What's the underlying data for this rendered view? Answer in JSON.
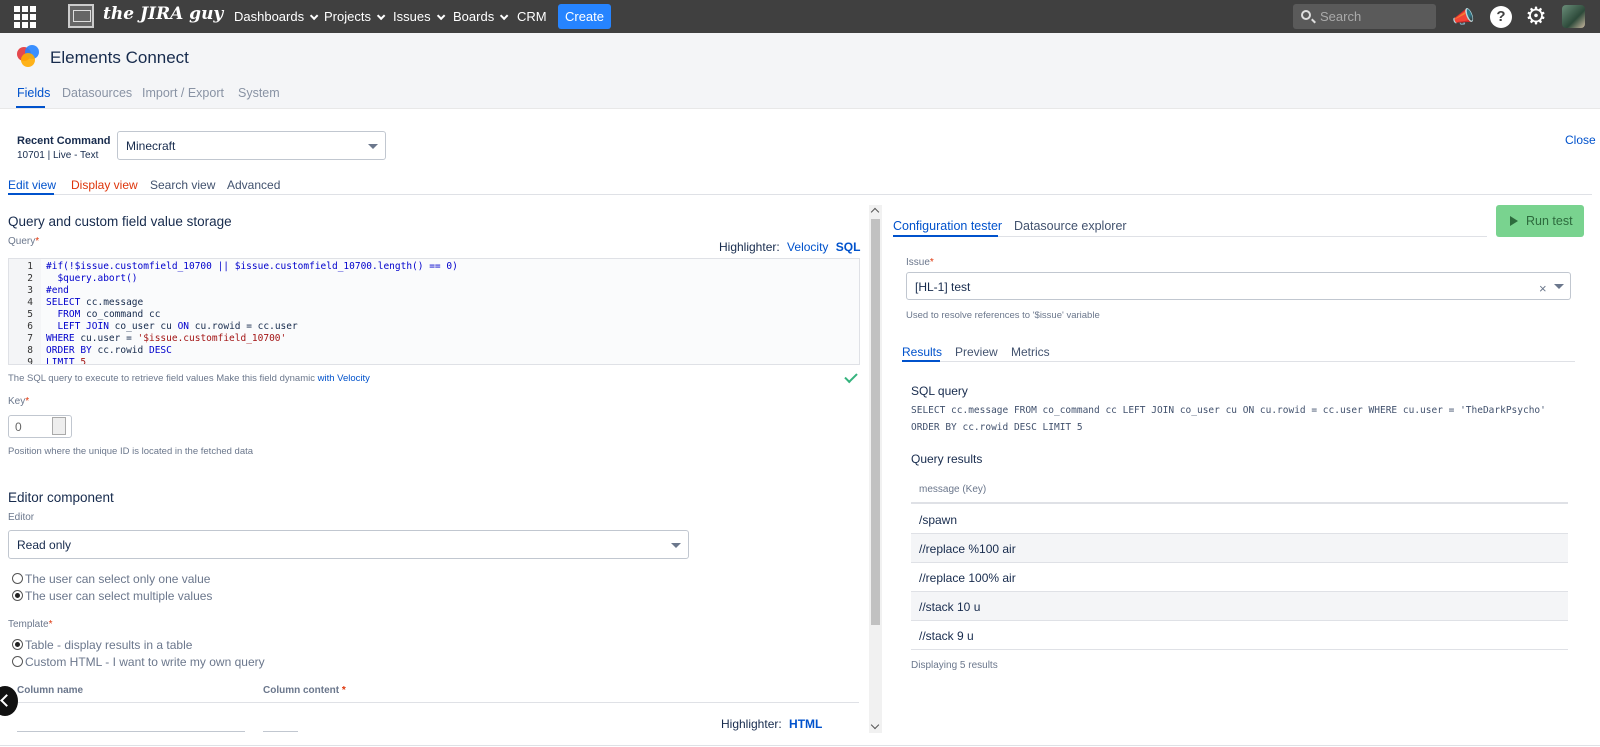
{
  "topnav": {
    "site_name": "the JIRA guy",
    "items": [
      {
        "label": "Dashboards"
      },
      {
        "label": "Projects"
      },
      {
        "label": "Issues"
      },
      {
        "label": "Boards"
      },
      {
        "label": "CRM"
      }
    ],
    "create_label": "Create",
    "search_placeholder": "Search",
    "help_glyph": "?",
    "icons": [
      "apps-grid-icon",
      "site-logo-icon",
      "megaphone-icon",
      "help-icon",
      "gear-icon",
      "avatar"
    ]
  },
  "header": {
    "title": "Elements Connect",
    "tabs": [
      "Fields",
      "Datasources",
      "Import / Export",
      "System"
    ],
    "active_tab": "Fields"
  },
  "field": {
    "name": "Recent Command",
    "meta": "10701 | Live - Text",
    "selected_context": "Minecraft",
    "close_label": "Close"
  },
  "view_tabs": [
    "Edit view",
    "Display view",
    "Search view",
    "Advanced"
  ],
  "left": {
    "section_title": "Query and custom field value storage",
    "query_label": "Query",
    "required_mark": "*",
    "highlighter_label": "Highlighter:",
    "highlighter_options": [
      "Velocity",
      "SQL"
    ],
    "query_help_text": "The SQL query to execute to retrieve field values Make this field dynamic ",
    "query_help_link": "with Velocity",
    "key_label": "Key",
    "key_value": "0",
    "key_help": "Position where the unique ID is located in the fetched data",
    "editor_section_title": "Editor component",
    "editor_label": "Editor",
    "editor_value": "Read only",
    "selection_options": [
      {
        "label": "The user can select only one value",
        "checked": false
      },
      {
        "label": "The user can select multiple values",
        "checked": true
      }
    ],
    "template_label": "Template",
    "template_options": [
      {
        "label": "Table - display results in a table",
        "checked": true
      },
      {
        "label": "Custom HTML - I want to write my own query",
        "checked": false
      }
    ],
    "column_name_label": "Column name",
    "column_content_label": "Column content",
    "html_highlighter_label": "Highlighter:",
    "html_highlighter_option": "HTML"
  },
  "right": {
    "tabs": [
      "Configuration tester",
      "Datasource explorer"
    ],
    "active_tab": "Configuration tester",
    "run_label": "Run test",
    "issue_label": "Issue",
    "issue_value": "[HL-1] test",
    "issue_clear": "×",
    "issue_help": "Used to resolve references to '$issue' variable",
    "result_tabs": [
      "Results",
      "Preview",
      "Metrics"
    ],
    "active_result_tab": "Results",
    "sql_title": "SQL query",
    "sql_text": "SELECT cc.message FROM co_command cc LEFT JOIN co_user cu ON cu.rowid = cc.user WHERE cu.user = 'TheDarkPsycho' ORDER BY cc.rowid DESC LIMIT 5",
    "results_title": "Query results",
    "column_header": "message (Key)",
    "rows": [
      "/spawn",
      "//replace %100 air",
      "//replace 100% air",
      "//stack 10 u",
      "//stack 9 u"
    ],
    "footer": "Displaying 5 results"
  },
  "colors": {
    "topnav_bg": "#404040",
    "accent": "#0052cc",
    "create_button": "#2684ff",
    "run_button": "#79d38f",
    "required": "#de350b"
  }
}
